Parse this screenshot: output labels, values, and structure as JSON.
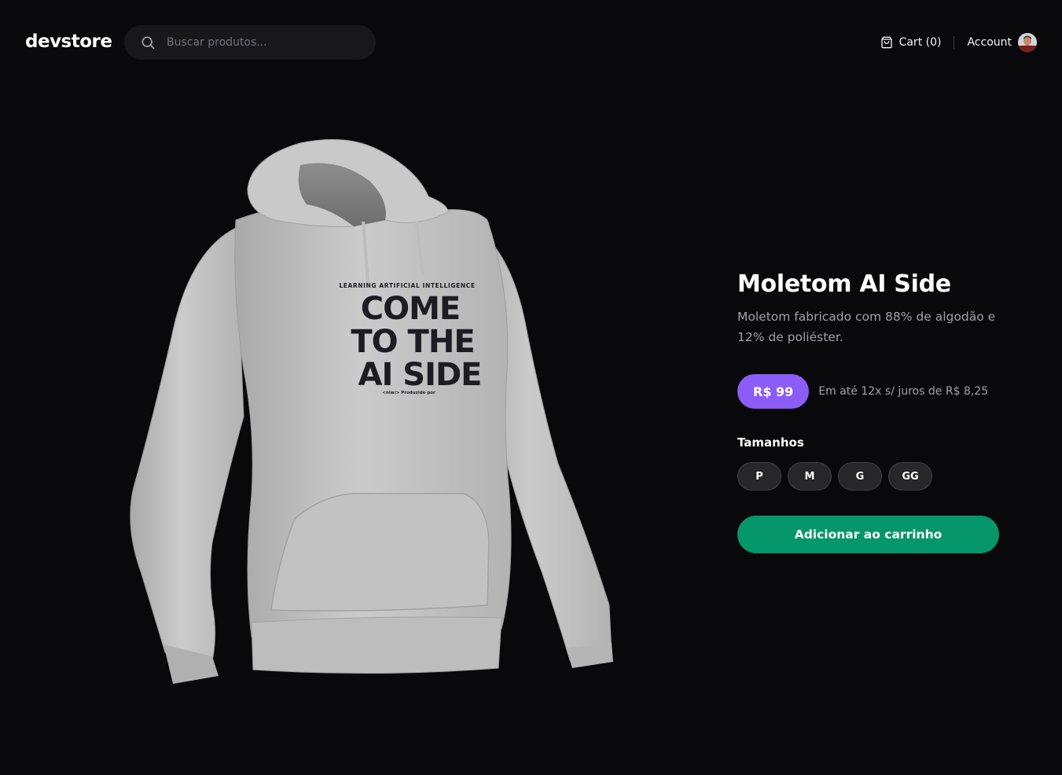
{
  "header": {
    "logo": "devstore",
    "search": {
      "placeholder": "Buscar produtos...",
      "value": "",
      "icon": "search-icon"
    },
    "cart": {
      "label": "Cart (0)",
      "icon": "shopping-bag-icon"
    },
    "account": {
      "label": "Account",
      "avatar": "user-avatar"
    }
  },
  "product": {
    "image": {
      "print_top_line": "LEARNING ARTIFICIAL INTELLIGENCE",
      "print_line_1": "COME",
      "print_line_2": "TO THE",
      "print_line_3": "AI SIDE",
      "print_footer": "<niw/> Produzido por"
    },
    "title": "Moletom AI Side",
    "description": "Moletom fabricado com 88% de algodão e 12% de poliéster.",
    "price": "R$ 99",
    "installments": "Em até 12x s/ juros de R$ 8,25",
    "sizes_label": "Tamanhos",
    "sizes": [
      "P",
      "M",
      "G",
      "GG"
    ],
    "add_to_cart_label": "Adicionar ao carrinho"
  },
  "colors": {
    "background": "#09090b",
    "price_badge": "#8b5cf6",
    "add_to_cart": "#059669",
    "hoodie": "#c7c7c7"
  }
}
